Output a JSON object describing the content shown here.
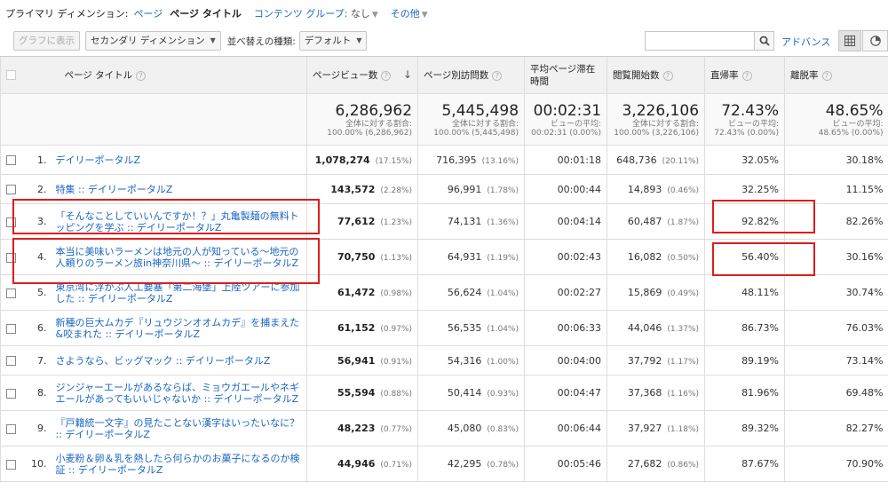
{
  "dimension_bar": {
    "primary_label": "プライマリ ディメンション:",
    "opt_page": "ページ",
    "opt_page_title": "ページ タイトル",
    "opt_content_group": "コンテンツ グループ:",
    "content_group_value": "なし",
    "opt_other": "その他"
  },
  "toolbar": {
    "graph_button": "グラフに表示",
    "secondary_dimension": "セカンダリ ディメンション",
    "sort_label": "並べ替えの種類:",
    "sort_value": "デフォルト",
    "search_value": "",
    "advanced": "アドバンス"
  },
  "columns": {
    "title": "ページ タイトル",
    "pageviews": "ページビュー数",
    "unique": "ページ別訪問数",
    "avgtime": "平均ページ滞在時間",
    "entrances": "閲覧開始数",
    "bounce": "直帰率",
    "exit": "離脱率"
  },
  "totals": {
    "pageviews": "6,286,962",
    "pageviews_sub1": "全体に対する割合:",
    "pageviews_sub2": "100.00% (6,286,962)",
    "unique": "5,445,498",
    "unique_sub1": "全体に対する割合:",
    "unique_sub2": "100.00% (5,445,498)",
    "avgtime": "00:02:31",
    "avgtime_sub1": "ビューの平均:",
    "avgtime_sub2": "00:02:31 (0.00%)",
    "entrances": "3,226,106",
    "entrances_sub1": "全体に対する割合:",
    "entrances_sub2": "100.00% (3,226,106)",
    "bounce": "72.43%",
    "bounce_sub1": "ビューの平均:",
    "bounce_sub2": "72.43% (0.00%)",
    "exit": "48.65%",
    "exit_sub1": "ビューの平均:",
    "exit_sub2": "48.65% (0.00%)"
  },
  "rows": [
    {
      "idx": "1.",
      "title": "デイリーポータルZ",
      "pv": "1,078,274",
      "pv_pct": "(17.15%)",
      "uv": "716,395",
      "uv_pct": "(13.16%)",
      "time": "00:01:18",
      "ent": "648,736",
      "ent_pct": "(20.11%)",
      "bounce": "32.05%",
      "exit": "30.18%"
    },
    {
      "idx": "2.",
      "title": "特集 :: デイリーポータルZ",
      "pv": "143,572",
      "pv_pct": "(2.28%)",
      "uv": "96,991",
      "uv_pct": "(1.78%)",
      "time": "00:00:44",
      "ent": "14,893",
      "ent_pct": "(0.46%)",
      "bounce": "32.25%",
      "exit": "11.15%"
    },
    {
      "idx": "3.",
      "title": "「そんなことしていいんですか！？」丸亀製麺の無料トッピングを学ぶ :: デイリーポータルZ",
      "pv": "77,612",
      "pv_pct": "(1.23%)",
      "uv": "74,131",
      "uv_pct": "(1.36%)",
      "time": "00:04:14",
      "ent": "60,487",
      "ent_pct": "(1.87%)",
      "bounce": "92.82%",
      "exit": "82.26%"
    },
    {
      "idx": "4.",
      "title": "本当に美味いラーメンは地元の人が知っている〜地元の人頼りのラーメン旅in神奈川県〜 :: デイリーポータルZ",
      "pv": "70,750",
      "pv_pct": "(1.13%)",
      "uv": "64,931",
      "uv_pct": "(1.19%)",
      "time": "00:02:43",
      "ent": "16,082",
      "ent_pct": "(0.50%)",
      "bounce": "56.40%",
      "exit": "30.16%"
    },
    {
      "idx": "5.",
      "title": "東京湾に浮かぶ人工要塞「第二海堡」上陸ツアーに参加した :: デイリーポータルZ",
      "pv": "61,472",
      "pv_pct": "(0.98%)",
      "uv": "56,624",
      "uv_pct": "(1.04%)",
      "time": "00:02:27",
      "ent": "15,869",
      "ent_pct": "(0.49%)",
      "bounce": "48.11%",
      "exit": "30.74%"
    },
    {
      "idx": "6.",
      "title": "新種の巨大ムカデ『リュウジンオオムカデ』を捕まえた&咬まれた :: デイリーポータルZ",
      "pv": "61,152",
      "pv_pct": "(0.97%)",
      "uv": "56,535",
      "uv_pct": "(1.04%)",
      "time": "00:06:33",
      "ent": "44,046",
      "ent_pct": "(1.37%)",
      "bounce": "86.73%",
      "exit": "76.03%"
    },
    {
      "idx": "7.",
      "title": "さようなら、ビッグマック :: デイリーポータルZ",
      "pv": "56,941",
      "pv_pct": "(0.91%)",
      "uv": "54,316",
      "uv_pct": "(1.00%)",
      "time": "00:04:00",
      "ent": "37,792",
      "ent_pct": "(1.17%)",
      "bounce": "89.19%",
      "exit": "73.14%"
    },
    {
      "idx": "8.",
      "title": "ジンジャーエールがあるならば、ミョウガエールやネギエールがあってもいいじゃないか :: デイリーポータルZ",
      "pv": "55,594",
      "pv_pct": "(0.88%)",
      "uv": "50,414",
      "uv_pct": "(0.93%)",
      "time": "00:04:47",
      "ent": "37,368",
      "ent_pct": "(1.16%)",
      "bounce": "81.96%",
      "exit": "69.48%"
    },
    {
      "idx": "9.",
      "title": "『戸籍統一文字』の見たことない漢字はいったいなに？ :: デイリーポータルZ",
      "pv": "48,223",
      "pv_pct": "(0.77%)",
      "uv": "45,080",
      "uv_pct": "(0.83%)",
      "time": "00:06:44",
      "ent": "37,927",
      "ent_pct": "(1.18%)",
      "bounce": "89.32%",
      "exit": "82.27%"
    },
    {
      "idx": "10.",
      "title": "小麦粉＆卵＆乳を熱したら何らかのお菓子になるのか検証 :: デイリーポータルZ",
      "pv": "44,946",
      "pv_pct": "(0.71%)",
      "uv": "42,295",
      "uv_pct": "(0.78%)",
      "time": "00:05:46",
      "ent": "27,682",
      "ent_pct": "(0.86%)",
      "bounce": "87.67%",
      "exit": "70.90%"
    }
  ],
  "colors": {
    "link": "#1a66c4",
    "highlight": "#e01b1b",
    "header_bg": "#f1f1f1"
  }
}
